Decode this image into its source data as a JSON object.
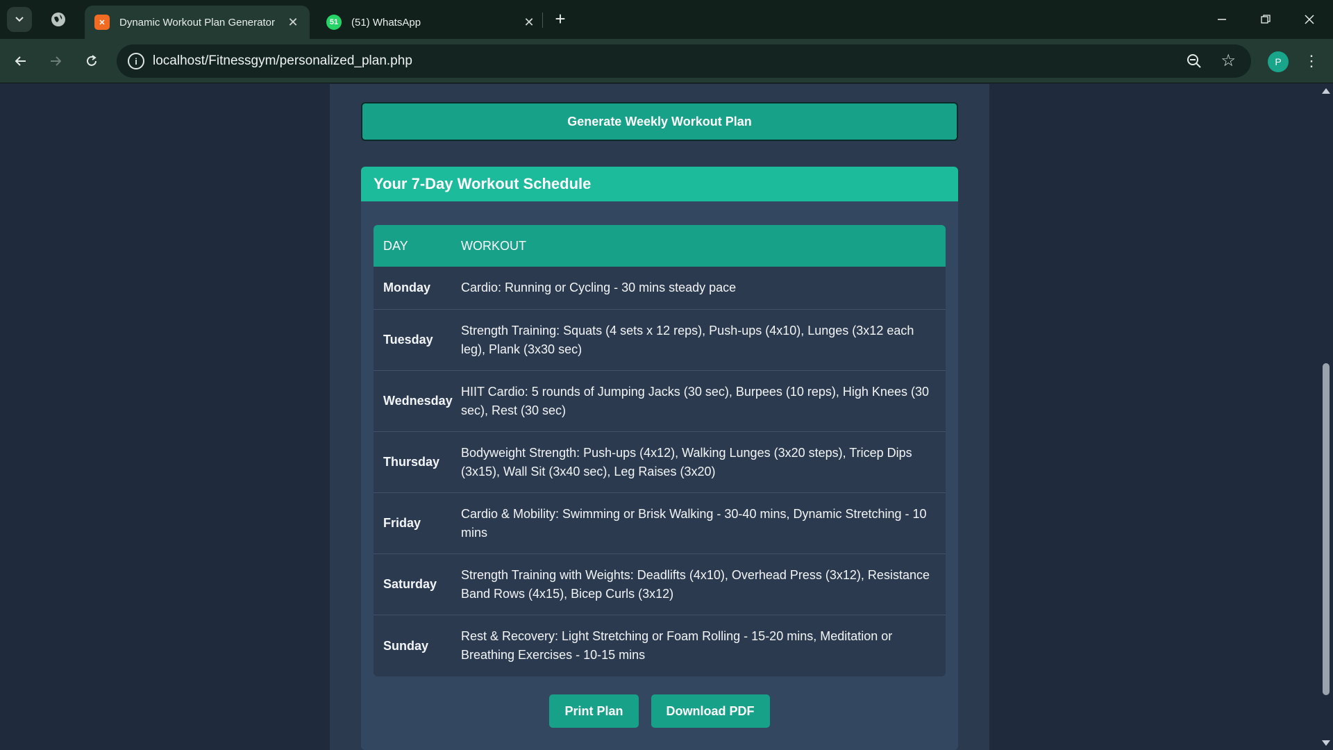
{
  "browser": {
    "tabs": [
      {
        "title": "Dynamic Workout Plan Generator",
        "favicon": "xampp-icon",
        "active": true
      },
      {
        "title": "(51) WhatsApp",
        "favicon": "whatsapp-icon",
        "badge": "51",
        "active": false
      }
    ],
    "url": "localhost/Fitnessgym/personalized_plan.php",
    "profile_initial": "P",
    "colors": {
      "tab_bar": "#12201c",
      "toolbar": "#243b34",
      "omnibox": "#142521"
    }
  },
  "page": {
    "generate_button": "Generate Weekly Workout Plan",
    "schedule": {
      "title": "Your 7-Day Workout Schedule",
      "columns": [
        "DAY",
        "WORKOUT"
      ],
      "rows": [
        {
          "day": "Monday",
          "workout": "Cardio: Running or Cycling - 30 mins steady pace"
        },
        {
          "day": "Tuesday",
          "workout": "Strength Training: Squats (4 sets x 12 reps), Push-ups (4x10), Lunges (3x12 each leg), Plank (3x30 sec)"
        },
        {
          "day": "Wednesday",
          "workout": "HIIT Cardio: 5 rounds of Jumping Jacks (30 sec), Burpees (10 reps), High Knees (30 sec), Rest (30 sec)"
        },
        {
          "day": "Thursday",
          "workout": "Bodyweight Strength: Push-ups (4x12), Walking Lunges (3x20 steps), Tricep Dips (3x15), Wall Sit (3x40 sec), Leg Raises (3x20)"
        },
        {
          "day": "Friday",
          "workout": "Cardio & Mobility: Swimming or Brisk Walking - 30-40 mins, Dynamic Stretching - 10 mins"
        },
        {
          "day": "Saturday",
          "workout": "Strength Training with Weights: Deadlifts (4x10), Overhead Press (3x12), Resistance Band Rows (4x15), Bicep Curls (3x12)"
        },
        {
          "day": "Sunday",
          "workout": "Rest & Recovery: Light Stretching or Foam Rolling - 15-20 mins, Meditation or Breathing Exercises - 10-15 mins"
        }
      ]
    },
    "actions": {
      "print": "Print Plan",
      "download": "Download PDF"
    },
    "colors": {
      "accent": "#17a188",
      "header": "#1cbb9c",
      "background": "#1f2b3d",
      "card": "#344761"
    }
  }
}
